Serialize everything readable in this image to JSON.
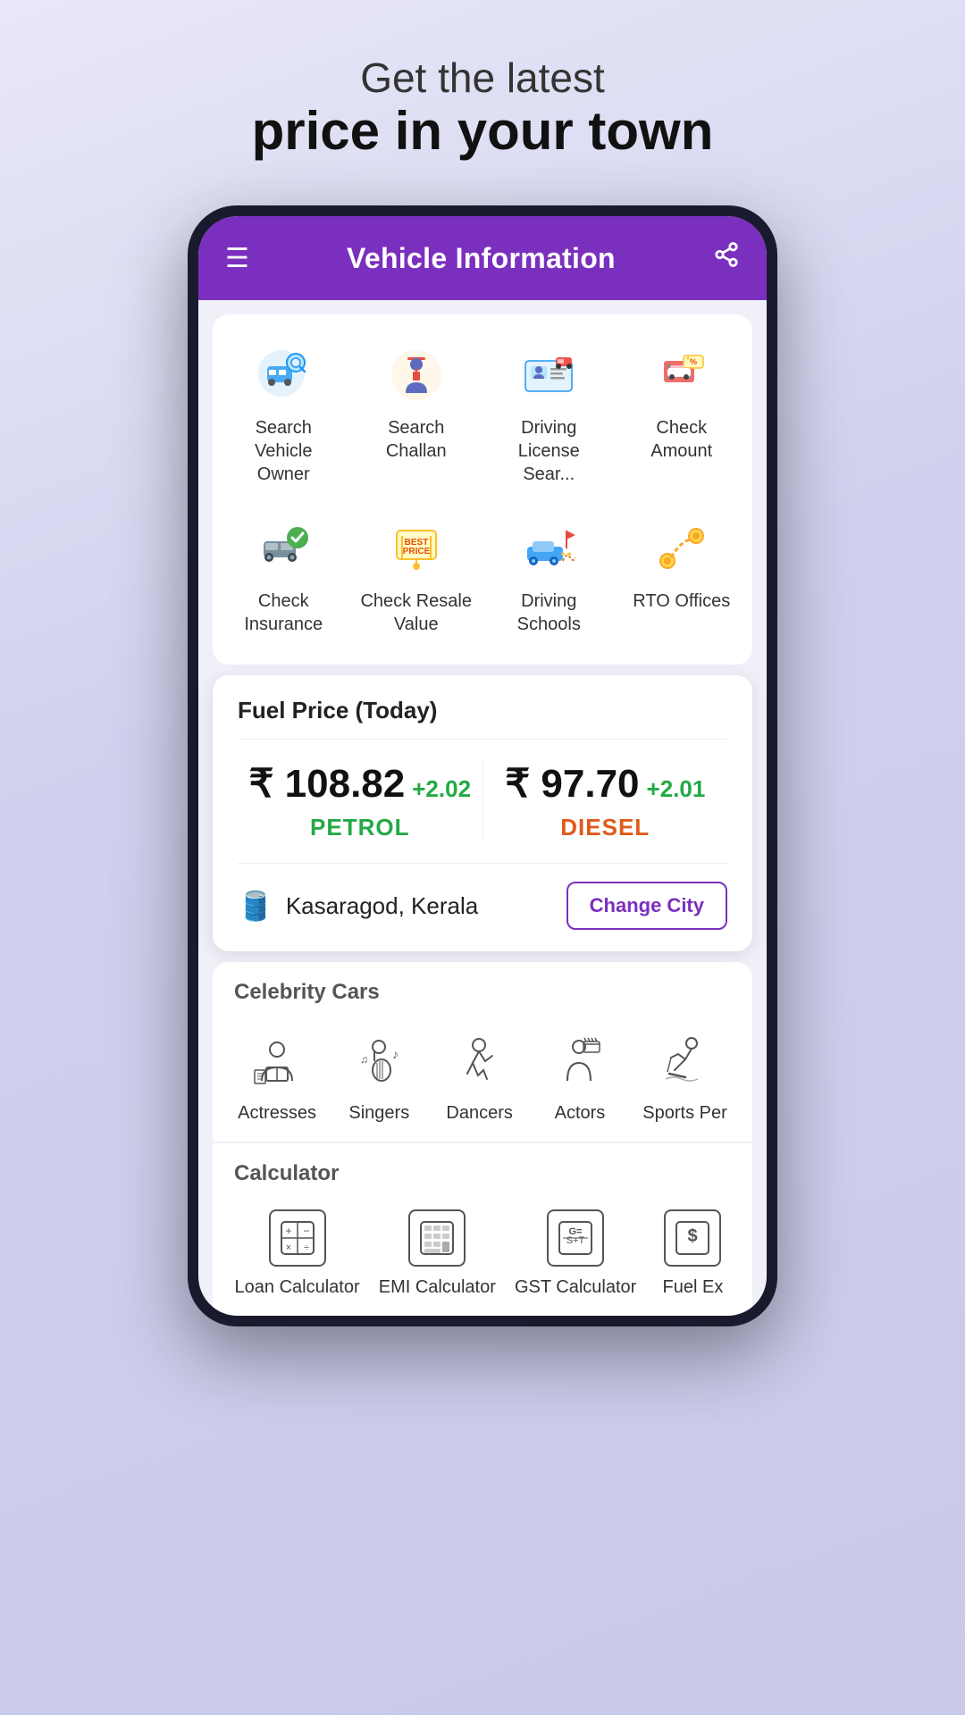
{
  "hero": {
    "sub_line": "Get the latest",
    "main_line": "price in your town"
  },
  "app": {
    "header_title": "Vehicle Information",
    "menu_icon": "☰",
    "share_icon": "⎘"
  },
  "vehicle_grid": {
    "items": [
      {
        "id": "search-vehicle-owner",
        "label": "Search Vehicle Owner",
        "icon": "🔍🚗"
      },
      {
        "id": "search-challan",
        "label": "Search Challan",
        "icon": "👮"
      },
      {
        "id": "driving-license",
        "label": "Driving License Sear...",
        "icon": "🪪"
      },
      {
        "id": "check-amount",
        "label": "Check Amount",
        "icon": "🏷️"
      },
      {
        "id": "check-insurance",
        "label": "Check Insurance",
        "icon": "🚗✅"
      },
      {
        "id": "check-resale-value",
        "label": "Check Resale Value",
        "icon": "🏷️"
      },
      {
        "id": "driving-schools",
        "label": "Driving Schools",
        "icon": "🚗🎓"
      },
      {
        "id": "rto-offices",
        "label": "RTO Offices",
        "icon": "🗺️"
      }
    ]
  },
  "fuel_card": {
    "title": "Fuel Price (Today)",
    "petrol_price": "₹ 108.82",
    "petrol_change": "+2.02",
    "petrol_label": "PETROL",
    "diesel_price": "₹ 97.70",
    "diesel_change": "+2.01",
    "diesel_label": "DIESEL",
    "city": "Kasaragod, Kerala",
    "change_city_label": "Change City"
  },
  "celebrity_section": {
    "title": "Celebrity Cars",
    "items": [
      {
        "id": "actresses",
        "label": "Actresses",
        "icon": "🎭"
      },
      {
        "id": "singers",
        "label": "Singers",
        "icon": "🎸"
      },
      {
        "id": "dancers",
        "label": "Dancers",
        "icon": "💃"
      },
      {
        "id": "actors",
        "label": "Actors",
        "icon": "🎬"
      },
      {
        "id": "sports-persons",
        "label": "Sports Per",
        "icon": "⛷️"
      }
    ]
  },
  "calculator_section": {
    "title": "Calculator",
    "items": [
      {
        "id": "loan-calculator",
        "label": "Loan Calculator",
        "icon": "🧮"
      },
      {
        "id": "emi-calculator",
        "label": "EMI Calculator",
        "icon": "📊"
      },
      {
        "id": "gst-calculator",
        "label": "GST Calculator",
        "icon": "🔢"
      },
      {
        "id": "fuel-ex",
        "label": "Fuel Ex",
        "icon": "💲"
      }
    ]
  }
}
